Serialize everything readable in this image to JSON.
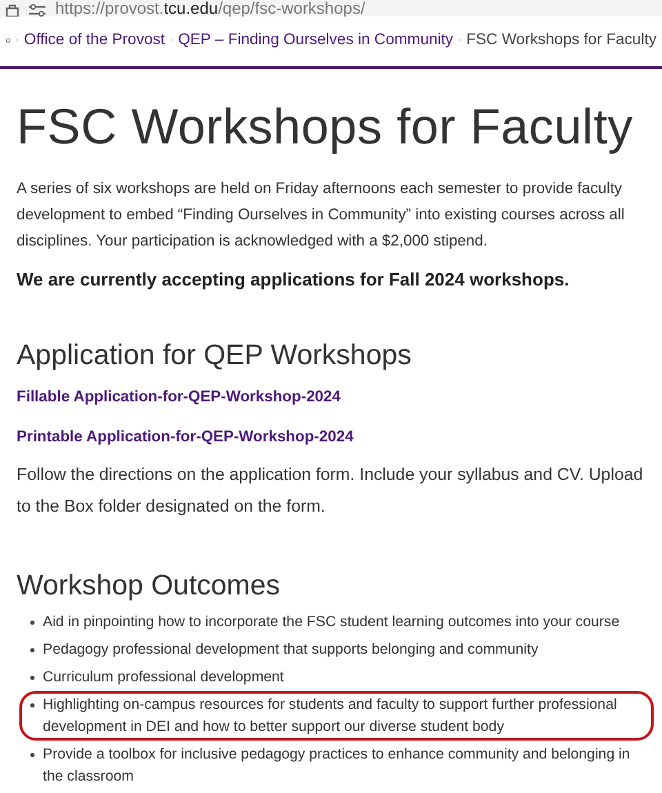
{
  "address_bar": {
    "url": "https://provost.**tcu.edu**/qep/fsc-workshops/"
  },
  "breadcrumb": [
    {
      "label": "Office of the Provost",
      "link": true
    },
    {
      "label": "QEP – Finding Ourselves in Community",
      "link": true
    },
    {
      "label": "FSC Workshops for Faculty",
      "link": false
    }
  ],
  "title": "FSC Workshops for Faculty",
  "intro": "A series of six workshops are held on Friday afternoons each semester to provide faculty development to embed “Finding Ourselves in Community” into existing courses across all disciplines. Your participation is acknowledged with a $2,000 stipend.",
  "notice": "We are currently accepting applications for Fall 2024 workshops.",
  "application": {
    "heading": "Application for QEP Workshops",
    "links": [
      "Fillable Application-for-QEP-Workshop-2024",
      "Printable Application-for-QEP-Workshop-2024"
    ],
    "instructions": "Follow the directions on the application form. Include your syllabus and CV. Upload to the Box folder designated on the form."
  },
  "outcomes": {
    "heading": "Workshop Outcomes",
    "items": [
      {
        "text": "Aid in pinpointing how to incorporate the FSC student learning outcomes into your course",
        "circled": false
      },
      {
        "text": "Pedagogy professional development that supports belonging and community",
        "circled": false
      },
      {
        "text": "Curriculum professional development",
        "circled": false
      },
      {
        "text": "Highlighting on-campus resources for students and faculty to support further professional development in DEI and how to better support our diverse student body",
        "circled": true
      },
      {
        "text": "Provide a toolbox for inclusive pedagogy practices to enhance community and belonging in the classroom",
        "circled": false
      }
    ]
  }
}
